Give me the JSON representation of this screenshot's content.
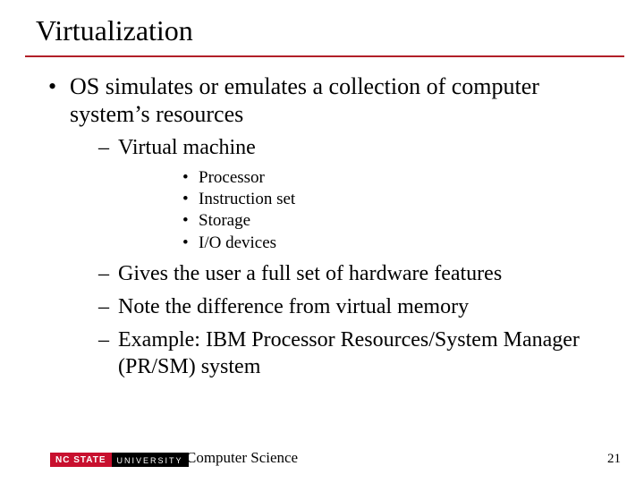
{
  "title": "Virtualization",
  "main_point": "OS simulates or emulates a collection of computer system’s resources",
  "sub": {
    "vm_label": "Virtual machine",
    "vm_items": [
      "Processor",
      "Instruction set",
      "Storage",
      "I/O devices"
    ],
    "gives": "Gives the user a full set of hardware features",
    "note": "Note the difference from virtual memory",
    "example": "Example: IBM Processor Resources/System Manager (PR/SM) system"
  },
  "footer": {
    "logo_left": "NC STATE",
    "logo_right": "UNIVERSITY",
    "dept": "Computer Science",
    "page": "21"
  },
  "colors": {
    "accent": "#b21f28",
    "logo_red": "#c8102e"
  }
}
